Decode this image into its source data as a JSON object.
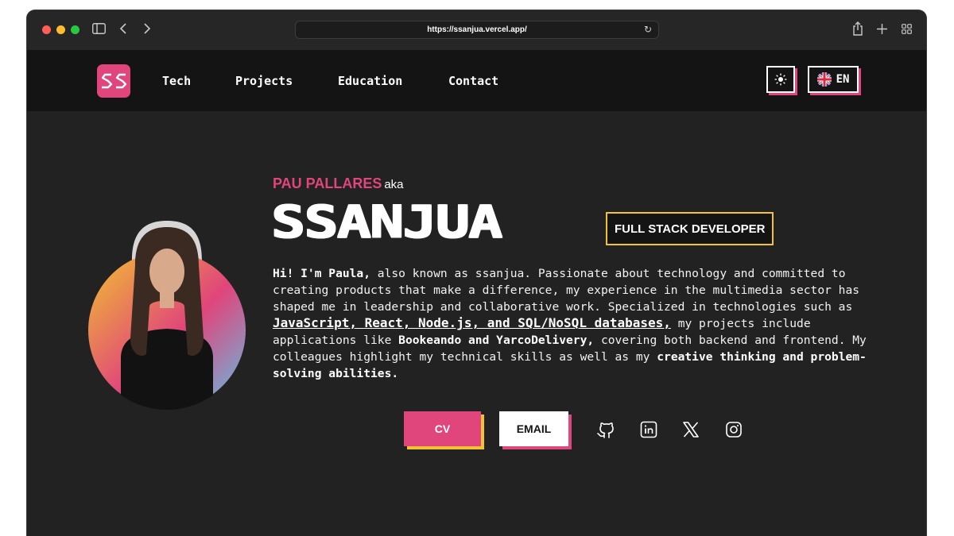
{
  "browser": {
    "url": "https://ssanjua.vercel.app/",
    "sidebar_icon": "sidebar-icon",
    "back_icon": "chevron-left-icon",
    "forward_icon": "chevron-right-icon",
    "reload_icon": "reload-icon",
    "share_icon": "share-icon",
    "new_tab_icon": "plus-icon",
    "tabs_overview_icon": "tabs-grid-icon"
  },
  "nav": {
    "logo": "SS",
    "links": [
      "Tech",
      "Projects",
      "Education",
      "Contact"
    ],
    "theme_icon": "sun-icon",
    "language": "EN",
    "language_flag": "uk-flag-icon"
  },
  "hero": {
    "full_name": "PAU PALLARES",
    "aka": "aka",
    "alias": "SSANJUA",
    "role": "FULL STACK DEVELOPER",
    "bio": {
      "greeting": "Hi! I'm Paula,",
      "text1": " also known as ssanjua. Passionate about technology and committed to creating products that make a difference, my experience in the multimedia sector has shaped me in leadership and collaborative work. Specialized in technologies such as ",
      "tech": "JavaScript, React, Node.js, and SQL/NoSQL databases,",
      "text2": " my projects include applications like ",
      "projects": "Bookeando and YarcoDelivery,",
      "text3": " covering both backend and frontend. My colleagues highlight my technical skills as well as my ",
      "closing": "creative thinking and problem-solving abilities."
    },
    "cv_button": "CV",
    "email_button": "EMAIL",
    "social_icons": [
      "github-icon",
      "linkedin-icon",
      "x-icon",
      "instagram-icon"
    ]
  },
  "colors": {
    "accent_pink": "#e0457b",
    "accent_yellow": "#f2c230",
    "page_bg": "#222222",
    "nav_bg": "#141414"
  }
}
